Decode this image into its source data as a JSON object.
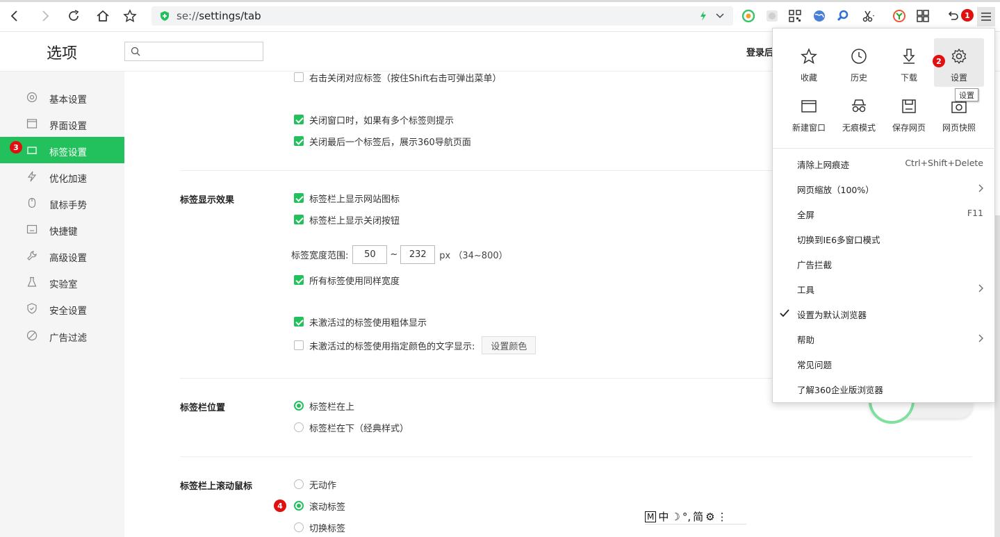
{
  "browser": {
    "url_prefix": "se://",
    "url_path": "settings/tab",
    "accent": "#23c15d"
  },
  "header": {
    "title": "选项",
    "search_placeholder": "",
    "login": "登录后"
  },
  "sidebar": {
    "items": [
      {
        "label": "基本设置",
        "icon": "gear-circle-icon"
      },
      {
        "label": "界面设置",
        "icon": "window-icon"
      },
      {
        "label": "标签设置",
        "icon": "tab-icon",
        "active": true
      },
      {
        "label": "优化加速",
        "icon": "bolt-icon"
      },
      {
        "label": "鼠标手势",
        "icon": "mouse-icon"
      },
      {
        "label": "快捷键",
        "icon": "keyboard-icon"
      },
      {
        "label": "高级设置",
        "icon": "wrench-icon"
      },
      {
        "label": "实验室",
        "icon": "flask-icon"
      },
      {
        "label": "安全设置",
        "icon": "shield-icon"
      },
      {
        "label": "广告过滤",
        "icon": "block-icon"
      }
    ]
  },
  "main": {
    "close_group": [
      {
        "label": "右击关闭对应标签（按住Shift右击可弹出菜单）",
        "checked": false
      },
      {
        "label": "关闭窗口时，如果有多个标签则提示",
        "checked": true
      },
      {
        "label": "关闭最后一个标签后，展示360导航页面",
        "checked": true
      }
    ],
    "display_section": {
      "title": "标签显示效果",
      "opt1": {
        "label": "标签栏上显示网站图标",
        "checked": true
      },
      "opt2": {
        "label": "标签栏上显示关闭按钮",
        "checked": true
      },
      "width_label": "标签宽度范围:",
      "width_min": "50",
      "tilde": "~",
      "width_max": "232",
      "width_unit": "px （34~800）",
      "opt3": {
        "label": "所有标签使用同样宽度",
        "checked": true
      },
      "opt4": {
        "label": "未激活过的标签使用粗体显示",
        "checked": true
      },
      "opt5": {
        "label": "未激活过的标签使用指定颜色的文字显示:",
        "checked": false
      },
      "color_button": "设置颜色"
    },
    "position_section": {
      "title": "标签栏位置",
      "options": [
        {
          "label": "标签栏在上",
          "selected": true
        },
        {
          "label": "标签栏在下（经典样式）",
          "selected": false
        }
      ]
    },
    "scroll_section": {
      "title": "标签栏上滚动鼠标",
      "options": [
        {
          "label": "无动作",
          "selected": false
        },
        {
          "label": "滚动标签",
          "selected": true
        },
        {
          "label": "切换标签",
          "selected": false
        }
      ]
    }
  },
  "menu": {
    "tiles": [
      {
        "label": "收藏",
        "icon": "star-icon"
      },
      {
        "label": "历史",
        "icon": "clock-icon"
      },
      {
        "label": "下载",
        "icon": "download-icon"
      },
      {
        "label": "设置",
        "icon": "gear-icon"
      },
      {
        "label": "新建窗口",
        "icon": "new-window-icon"
      },
      {
        "label": "无痕模式",
        "icon": "incognito-icon"
      },
      {
        "label": "保存网页",
        "icon": "save-icon"
      },
      {
        "label": "网页快照",
        "icon": "camera-icon"
      }
    ],
    "items": [
      {
        "label": "清除上网痕迹",
        "shortcut": "Ctrl+Shift+Delete"
      },
      {
        "label": "网页缩放（100%）",
        "arrow": true
      },
      {
        "label": "全屏",
        "shortcut": "F11"
      },
      {
        "label": "切换到IE6多窗口模式"
      },
      {
        "label": "广告拦截"
      },
      {
        "label": "工具",
        "arrow": true
      },
      {
        "label": "设置为默认浏览器",
        "checked": true
      },
      {
        "label": "帮助",
        "arrow": true
      },
      {
        "label": "常见问题"
      },
      {
        "label": "了解360企业版浏览器"
      }
    ],
    "tooltip": "设置"
  },
  "markers": [
    "1",
    "2",
    "3",
    "4"
  ],
  "ime": [
    "M",
    "中",
    "☽",
    "°,",
    "简",
    "⚙",
    "⋮"
  ]
}
